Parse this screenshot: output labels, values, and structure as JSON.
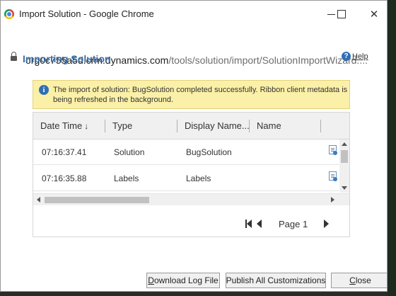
{
  "window": {
    "title": "Import Solution - Google Chrome",
    "controls": {
      "minimize": "minimize",
      "maximize": "maximize",
      "close": "✕"
    }
  },
  "address": {
    "host": "org0c755a5d.crm.dynamics.com",
    "path": "/tools/solution/import/SolutionImportWizard...."
  },
  "dialog": {
    "title": "Importing Solution",
    "help_label": "Help"
  },
  "info": {
    "message": "The import of solution: BugSolution completed successfully. Ribbon client metadata is being refreshed in the background."
  },
  "grid": {
    "columns": [
      "Date Time",
      "Type",
      "Display Name...",
      "Name"
    ],
    "sort_indicator": "↓",
    "rows": [
      {
        "time": "07:16:37.41",
        "type": "Solution",
        "display_name": "BugSolution",
        "name": ""
      },
      {
        "time": "07:16:35.88",
        "type": "Labels",
        "display_name": "Labels",
        "name": ""
      }
    ]
  },
  "pager": {
    "label": "Page 1"
  },
  "buttons": {
    "download_access": "D",
    "download_rest": "ownload Log File",
    "publish": "Publish All Customizations",
    "close_access": "C",
    "close_rest": "lose"
  },
  "colors": {
    "accent": "#3b6fa7",
    "info_background": "#fbf0a7"
  }
}
